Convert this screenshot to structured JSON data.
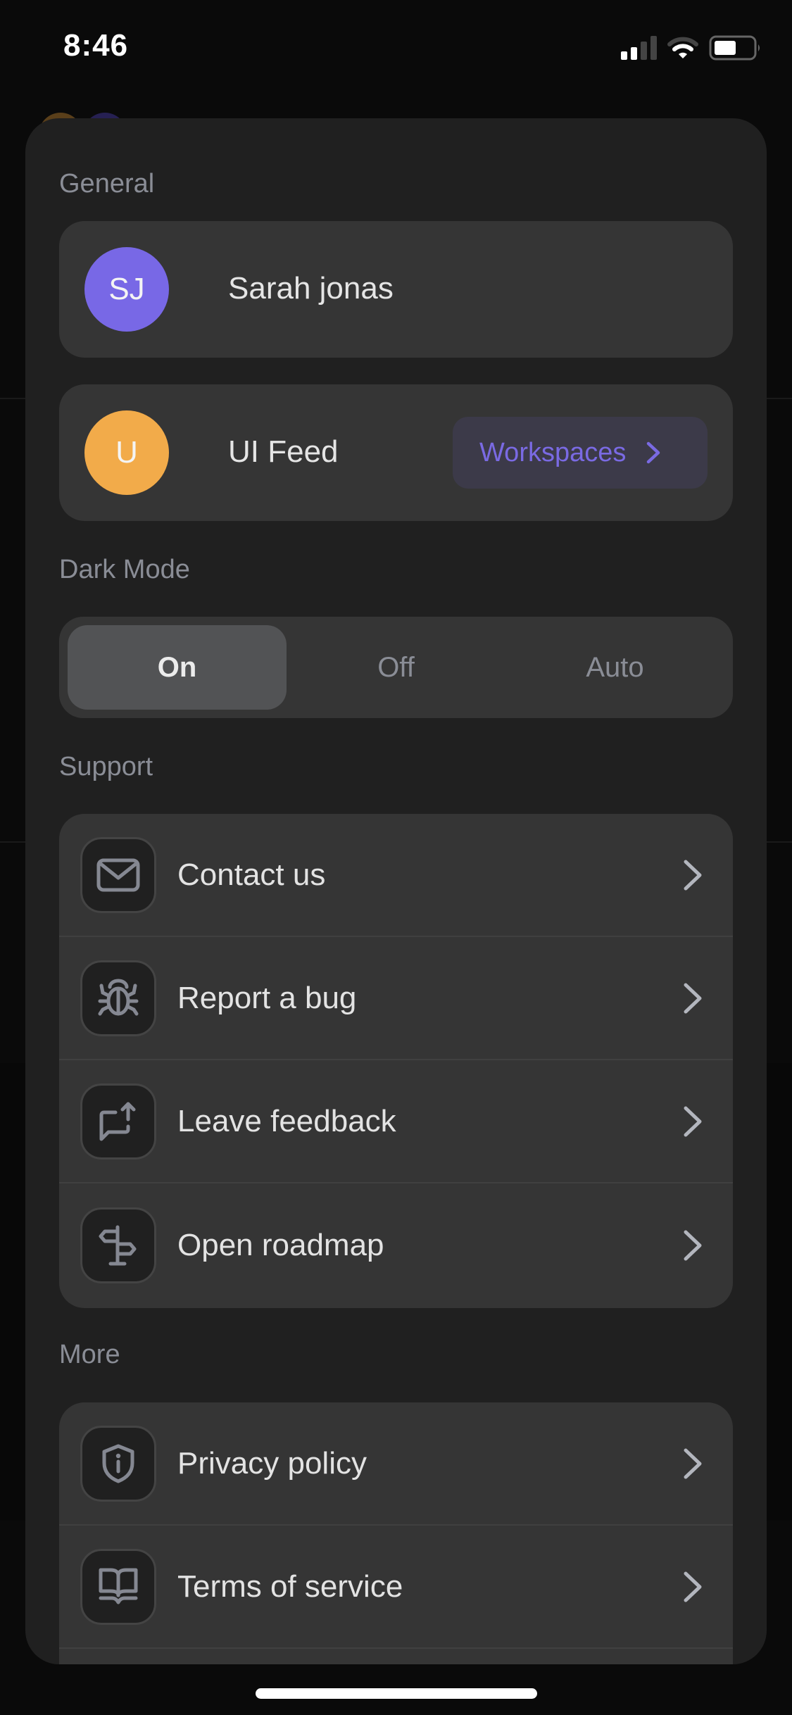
{
  "status_bar": {
    "time": "8:46",
    "signal_bars_active": 2,
    "signal_bars_total": 4,
    "battery_level": 0.5,
    "icons": [
      "cellular-signal-icon",
      "wifi-icon",
      "battery-icon"
    ]
  },
  "sections": {
    "general": {
      "label": "General",
      "user": {
        "initials": "SJ",
        "name": "Sarah jonas",
        "avatar_color": "#7868e6"
      },
      "workspace": {
        "initials": "U",
        "name": "UI Feed",
        "avatar_color": "#f2ab4a",
        "button_label": "Workspaces",
        "button_icon": "chevron-right-icon"
      }
    },
    "dark_mode": {
      "label": "Dark Mode",
      "options": [
        "On",
        "Off",
        "Auto"
      ],
      "selected": "On"
    },
    "support": {
      "label": "Support",
      "items": [
        {
          "label": "Contact us",
          "icon": "mail-icon"
        },
        {
          "label": "Report a bug",
          "icon": "bug-icon"
        },
        {
          "label": "Leave feedback",
          "icon": "feedback-icon"
        },
        {
          "label": "Open roadmap",
          "icon": "signpost-icon"
        }
      ]
    },
    "more": {
      "label": "More",
      "items": [
        {
          "label": "Privacy policy",
          "icon": "shield-info-icon"
        },
        {
          "label": "Terms of service",
          "icon": "book-icon"
        }
      ]
    }
  },
  "colors": {
    "accent": "#7868e6",
    "accent_bg": "#3c3a49",
    "sheet_bg": "#202020",
    "card_bg": "#353535",
    "muted_text": "#8a8d96",
    "icon_stroke": "#858892"
  }
}
